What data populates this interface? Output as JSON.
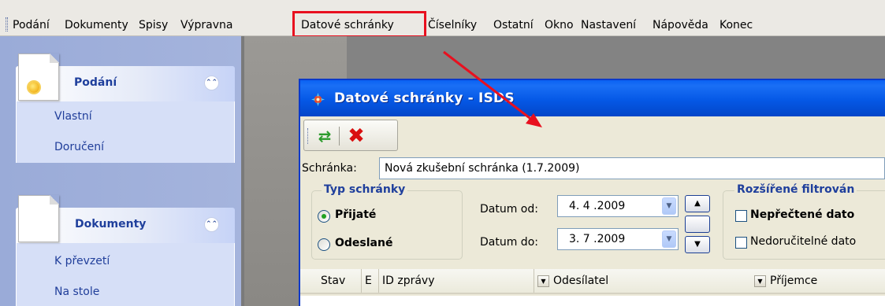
{
  "menubar": {
    "items": [
      "Podání",
      "Dokumenty",
      "Spisy",
      "Výpravna",
      "Datové schránky",
      "Číselníky",
      "Ostatní",
      "Okno",
      "Nastavení",
      "Nápověda",
      "Konec"
    ],
    "highlighted": "Datové schránky"
  },
  "sidebar": {
    "panels": [
      {
        "title": "Podání",
        "icon": "sun-icon",
        "links": [
          "Vlastní",
          "Doručení"
        ]
      },
      {
        "title": "Dokumenty",
        "icon": "page-icon",
        "links": [
          "K převzetí",
          "Na stole"
        ]
      }
    ],
    "collapse_symbol": "⌃⌃"
  },
  "dialog": {
    "title": "Datové schránky - ISDS",
    "toolbar": {
      "refresh_icon": "refresh-icon",
      "delete_icon": "delete-icon"
    },
    "mailbox_label": "Schránka:",
    "mailbox_value": "Nová zkušební schránka (1.7.2009)",
    "type_group": {
      "title": "Typ schránky",
      "options": [
        {
          "label": "Přijaté",
          "selected": true
        },
        {
          "label": "Odeslané",
          "selected": false
        }
      ]
    },
    "date_from_label": "Datum od:",
    "date_from_value": "4. 4 .2009",
    "date_to_label": "Datum do:",
    "date_to_value": "3. 7 .2009",
    "filter_group": {
      "title": "Rozšířené filtrován",
      "options": [
        "Nepřečtené dato",
        "Nedoručitelné dato"
      ]
    },
    "grid": {
      "columns": [
        "Stav",
        "E",
        "ID zprávy",
        "Odesílatel",
        "Příjemce"
      ]
    }
  },
  "colors": {
    "annotation": "#e8101f",
    "titlebar": "#0558e6",
    "nav_link": "#203e9a"
  }
}
